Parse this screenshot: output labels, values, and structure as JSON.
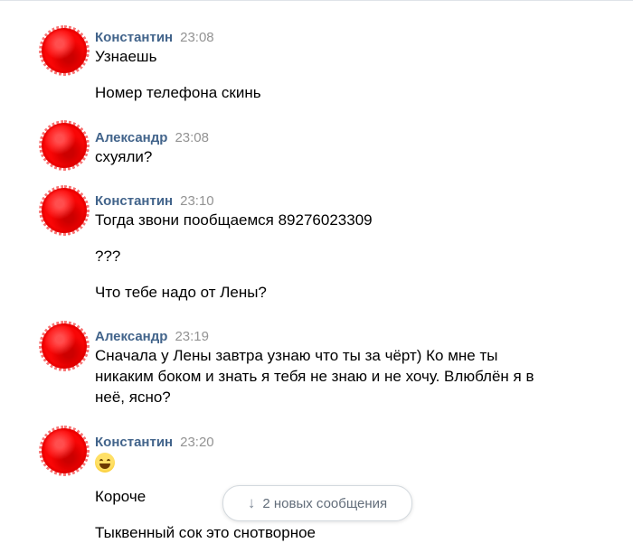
{
  "messages": [
    {
      "author": "Константин",
      "time": "23:08",
      "lines": [
        "Узнаешь",
        "Номер телефона скинь"
      ]
    },
    {
      "author": "Александр",
      "time": "23:08",
      "lines": [
        "схуяли?"
      ]
    },
    {
      "author": "Константин",
      "time": "23:10",
      "lines": [
        "Тогда звони пообщаемся 89276023309",
        "???",
        "Что тебе надо от Лены?"
      ]
    },
    {
      "author": "Александр",
      "time": "23:19",
      "lines": [
        "Сначала у Лены завтра узнаю что ты за чёрт) Ко мне ты",
        "никаким боком и знать я тебя не знаю и не хочу. Влюблён я в",
        "неё, ясно?"
      ]
    },
    {
      "author": "Константин",
      "time": "23:20",
      "emoji": "grinning-face-emoji",
      "lines": [
        "Короче",
        "Тыквенный сок это снотворное"
      ]
    }
  ],
  "new_messages_button": {
    "label": "2 новых сообщения",
    "icon": "arrow-down-icon"
  },
  "colors": {
    "author": "#42648b",
    "time": "#939393",
    "text": "#000000",
    "avatar": "#ee1111"
  }
}
